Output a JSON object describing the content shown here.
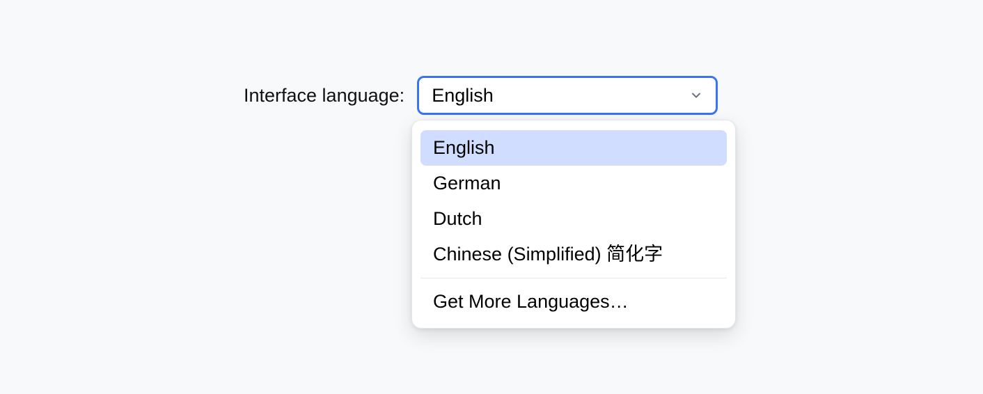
{
  "field": {
    "label": "Interface language:",
    "selected_value": "English"
  },
  "dropdown": {
    "options": [
      "English",
      "German",
      "Dutch",
      "Chinese (Simplified) 简化字"
    ],
    "more_label": "Get More Languages…",
    "selected_index": 0
  },
  "colors": {
    "accent": "#3a72f8",
    "highlight": "#d0ddff",
    "background": "#f8f9fa"
  }
}
